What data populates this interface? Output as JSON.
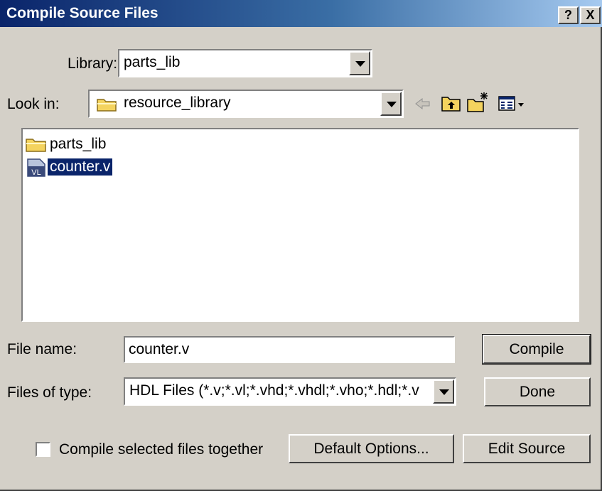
{
  "window": {
    "title": "Compile Source Files",
    "help_label": "?",
    "close_label": "X"
  },
  "library": {
    "label": "Library:",
    "value": "parts_lib"
  },
  "look_in": {
    "label": "Look in:",
    "value": "resource_library",
    "tools": [
      "back-arrow-icon",
      "up-folder-icon",
      "new-folder-icon",
      "view-menu-icon"
    ]
  },
  "files": [
    {
      "name": "parts_lib",
      "icon": "folder-icon",
      "selected": false
    },
    {
      "name": "counter.v",
      "icon": "verilog-file-icon",
      "icon_text": "VL",
      "selected": true
    }
  ],
  "file_name": {
    "label": "File name:",
    "value": "counter.v"
  },
  "file_type": {
    "label": "Files of type:",
    "value": "HDL Files (*.v;*.vl;*.vhd;*.vhdl;*.vho;*.hdl;*.v"
  },
  "buttons": {
    "compile": "Compile",
    "done": "Done",
    "default_options": "Default Options...",
    "edit_source": "Edit Source"
  },
  "compile_together": {
    "label": "Compile selected files together",
    "checked": false
  },
  "colors": {
    "face": "#d4d0c8",
    "title_start": "#0a246a",
    "selection": "#0a246a",
    "folder": "#f4d35e"
  }
}
